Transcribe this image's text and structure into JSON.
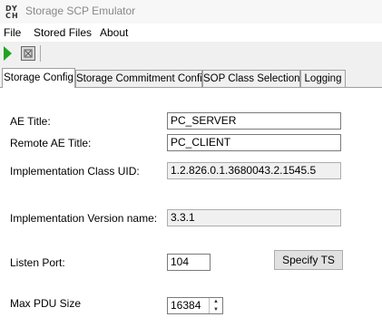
{
  "window": {
    "title": "Storage SCP Emulator"
  },
  "menu": {
    "items": [
      "File",
      "Stored Files",
      "About"
    ]
  },
  "tabs": [
    "Storage Config",
    "Storage Commitment Config",
    "SOP Class Selection",
    "Logging"
  ],
  "active_tab": "Storage Config",
  "form": {
    "ae_title_label": "AE Title:",
    "ae_title_value": "PC_SERVER",
    "remote_ae_label": "Remote AE Title:",
    "remote_ae_value": "PC_CLIENT",
    "impl_class_uid_label": "Implementation Class UID:",
    "impl_class_uid_value": "1.2.826.0.1.3680043.2.1545.5",
    "impl_version_label": "Implementation Version name:",
    "impl_version_value": "3.3.1",
    "listen_port_label": "Listen Port:",
    "listen_port_value": "104",
    "specify_ts_label": "Specify TS",
    "max_pdu_label": "Max PDU Size",
    "max_pdu_value": "16384"
  },
  "icons": {
    "app": "dicom-app-icon",
    "start": "play-icon",
    "stop": "stop-icon"
  },
  "colors": {
    "play": "#1ea51e"
  }
}
